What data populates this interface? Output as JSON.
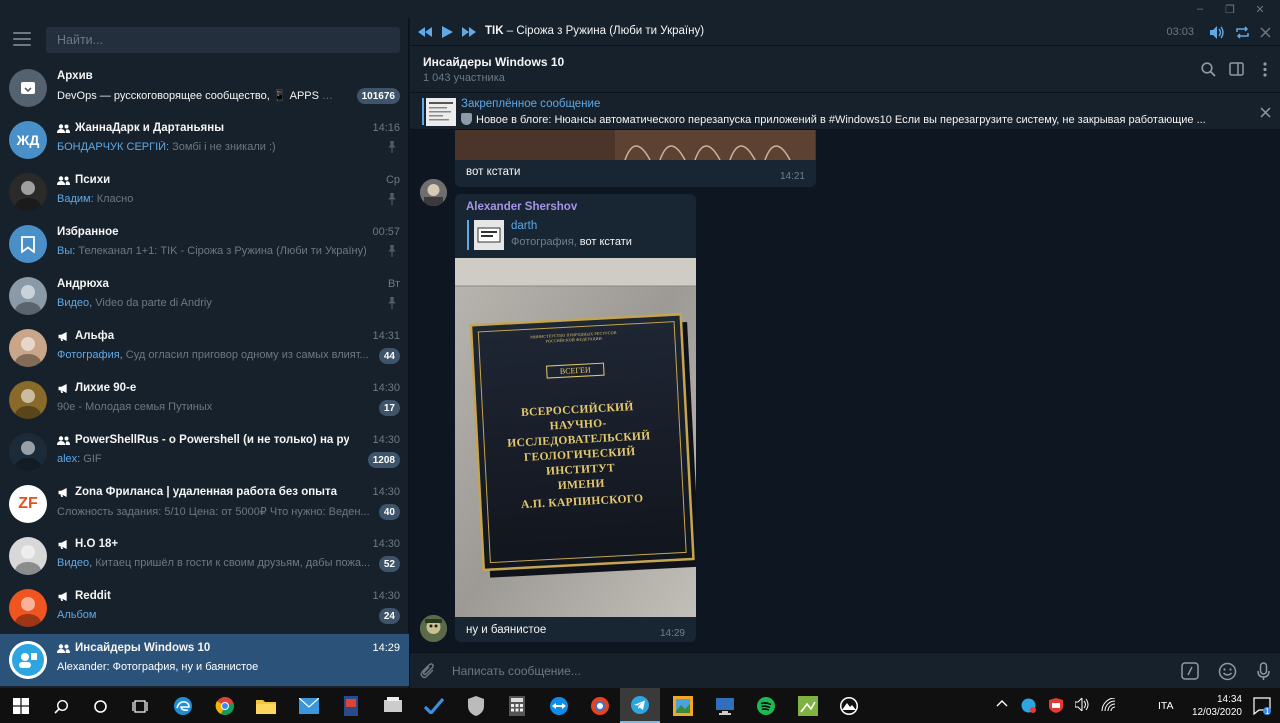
{
  "titlebar": {
    "minimize": "–",
    "restore": "❐",
    "close": "✕"
  },
  "sidebar": {
    "search_placeholder": "Найти...",
    "chats": [
      {
        "name": "Архив",
        "preview_sender": "",
        "preview": "DevOps — русскоговорящее сообщество, 📱 APPS FU...",
        "time": "",
        "badge": "101676",
        "avatar_bg": "#54626f",
        "avatar_text": "",
        "type": "archive"
      },
      {
        "name": "ЖаннаДарк и Дартаньяны",
        "preview_sender": "БОНДАРЧУК СЕРГІЙ: ",
        "preview": "Зомбі і не зникали :)",
        "time": "14:16",
        "badge": "",
        "pinned": true,
        "avatar_bg": "#4a90c8",
        "avatar_text": "ЖД",
        "type": "group"
      },
      {
        "name": "Психи",
        "preview_sender": "Вадим: ",
        "preview": "Класно",
        "time": "Ср",
        "badge": "",
        "pinned": true,
        "avatar_bg": "#2a2a2a",
        "avatar_text": "",
        "type": "group"
      },
      {
        "name": "Избранное",
        "preview_sender": "Вы: ",
        "preview": "Телеканал 1+1: TIK - Сірожа з Ружина (Люби ти Україну)",
        "time": "00:57",
        "badge": "",
        "pinned": true,
        "avatar_bg": "#4a90c8",
        "avatar_text": "",
        "type": "saved"
      },
      {
        "name": "Андрюха",
        "preview_sender": "Видео, ",
        "preview": "Video da parte di Andriy",
        "time": "Вт",
        "badge": "",
        "pinned": true,
        "avatar_bg": "#8a9aa8",
        "avatar_text": "",
        "type": "user"
      },
      {
        "name": "Альфа",
        "preview_sender": "Фотография, ",
        "preview": "Суд огласил приговор одному из самых влият...",
        "time": "14:31",
        "badge": "44",
        "avatar_bg": "#c9a58a",
        "avatar_text": "",
        "type": "channel"
      },
      {
        "name": "Лихие 90-е",
        "preview_sender": "",
        "preview": "90е - Молодая семья Путиных",
        "time": "14:30",
        "badge": "17",
        "avatar_bg": "#8a6a2a",
        "avatar_text": "",
        "type": "channel"
      },
      {
        "name": "PowerShellRus - о Powershell (и не только) на русском",
        "preview_sender": "alex: ",
        "preview": "GIF",
        "time": "14:30",
        "badge": "1208",
        "avatar_bg": "#1b2b3a",
        "avatar_text": "",
        "type": "group"
      },
      {
        "name": "Zona Фриланса | удаленная работа без опыта",
        "preview_sender": "",
        "preview": "Сложность задания: 5/10  Цена: от 5000₽  Что нужно: Веден...",
        "time": "14:30",
        "badge": "40",
        "avatar_bg": "#ffffff",
        "avatar_text": "ZF",
        "type": "channel"
      },
      {
        "name": "H.O 18+",
        "preview_sender": "Видео, ",
        "preview": "Китаец пришёл в гости к своим друзьям, дабы пожа...",
        "time": "14:30",
        "badge": "52",
        "avatar_bg": "#d8d8d8",
        "avatar_text": "",
        "type": "channel"
      },
      {
        "name": "Reddit",
        "preview_sender": "Альбом",
        "preview": "",
        "time": "14:30",
        "badge": "24",
        "avatar_bg": "#f0541f",
        "avatar_text": "",
        "type": "channel"
      },
      {
        "name": "Инсайдеры Windows 10",
        "preview_sender": "",
        "preview": "Alexander: Фотография, ну и баянистое",
        "time": "14:29",
        "badge": "",
        "avatar_bg": "#ffffff",
        "avatar_text": "",
        "type": "group",
        "active": true
      }
    ]
  },
  "player": {
    "title_bold": "TIK",
    "title_rest": " – Сірожа з Ружина (Люби ти Україну)",
    "time": "03:03"
  },
  "chat": {
    "title": "Инсайдеры Windows 10",
    "subtitle": "1 043 участника",
    "pinned_label": "Закреплённое сообщение",
    "pinned_text": "Новое в блоге: Нюансы автоматического перезапуска приложений в #Windows10  Если вы перезагрузите систему, не закрывая работающие ...",
    "msg1": {
      "text": "вот кстати",
      "time": "14:21"
    },
    "msg2": {
      "sender": "Alexander Shershov",
      "reply_name": "darth",
      "reply_kind": "Фотография, ",
      "reply_text": "вот кстати",
      "plaque_line0": "МИНИСТЕРСТВО ПРИРОДНЫХ РЕСУРСОВ РОССИЙСКОЙ ФЕДЕРАЦИИ",
      "plaque_logo": "ВСЕГЕИ",
      "plaque_lines": [
        "ВСЕРОССИЙСКИЙ",
        "НАУЧНО-",
        "ИССЛЕДОВАТЕЛЬСКИЙ",
        "ГЕОЛОГИЧЕСКИЙ",
        "ИНСТИТУТ",
        "ИМЕНИ",
        "А.П. КАРПИНСКОГО"
      ],
      "text": "ну и баянистое",
      "time": "14:29"
    },
    "composer_placeholder": "Написать сообщение..."
  },
  "taskbar": {
    "lang": "ITA",
    "time": "14:34",
    "date": "12/03/2020",
    "notif_count": "1"
  },
  "colors": {
    "accent": "#5fa9e6",
    "active_row": "#2b5278",
    "sidebar": "#17212b",
    "chat_bg": "#0e1621",
    "bubble": "#182533"
  }
}
